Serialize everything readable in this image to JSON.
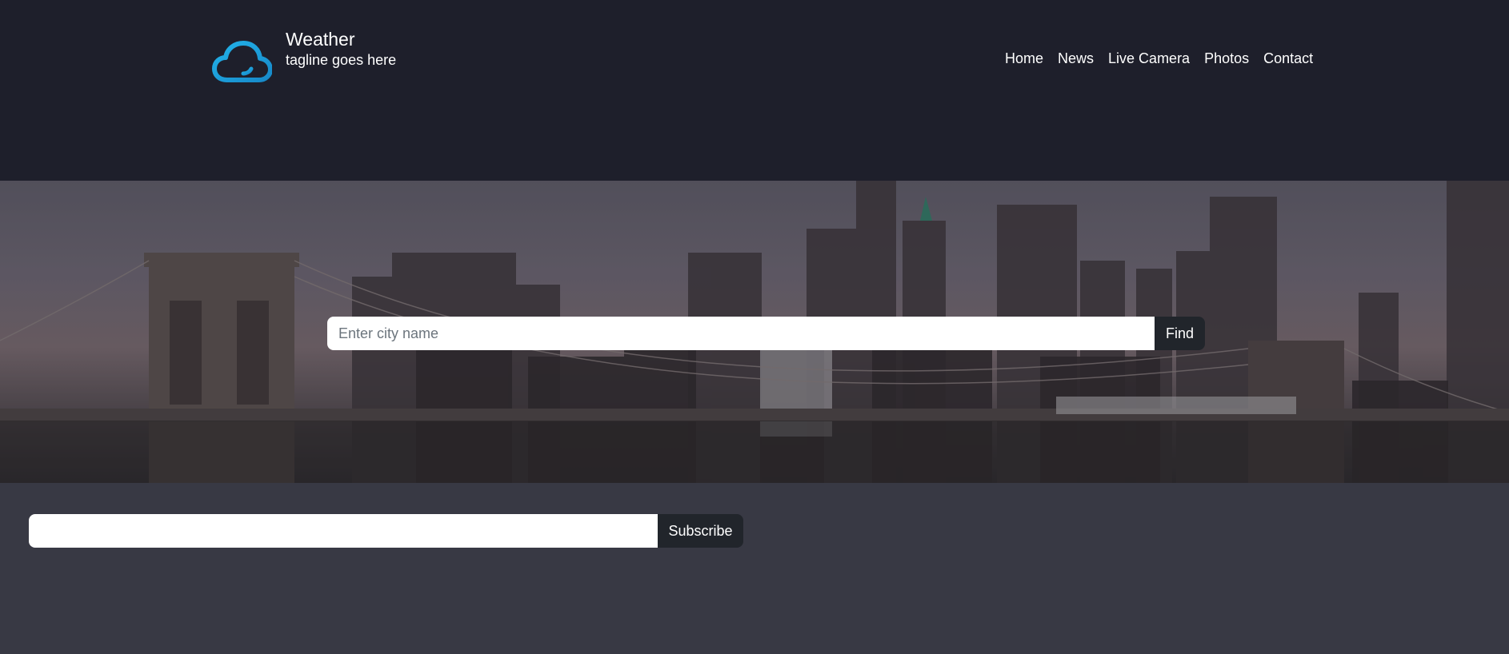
{
  "brand": {
    "title": "Weather",
    "tagline": "tagline goes here",
    "logo_icon": "cloud-icon",
    "logo_color": "#1da6e0"
  },
  "nav": {
    "items": [
      {
        "label": "Home"
      },
      {
        "label": "News"
      },
      {
        "label": "Live Camera"
      },
      {
        "label": "Photos"
      },
      {
        "label": "Contact"
      }
    ]
  },
  "search": {
    "placeholder": "Enter city name",
    "value": "",
    "button_label": "Find"
  },
  "subscribe": {
    "value": "",
    "button_label": "Subscribe"
  },
  "colors": {
    "header_bg": "#1e1f2b",
    "page_bg": "#383944",
    "button_bg": "#21252b"
  }
}
